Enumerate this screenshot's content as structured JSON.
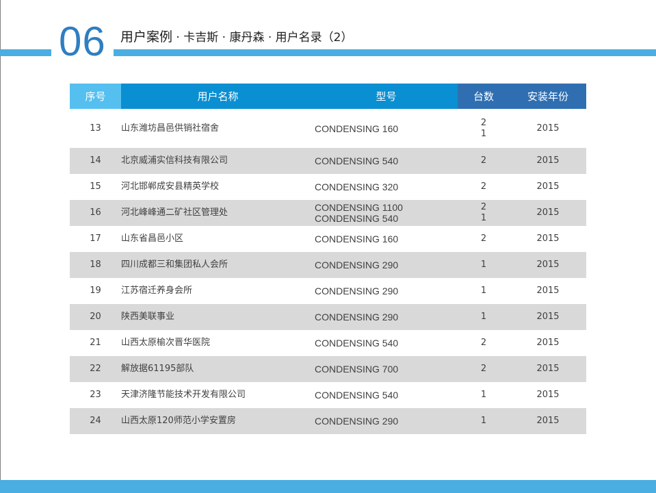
{
  "header": {
    "section_number": "06",
    "title_main": "用户案例",
    "title_sub": " · 卡吉斯 · 康丹森 · 用户名录（2）"
  },
  "table": {
    "headers": {
      "seq": "序号",
      "name": "用户名称",
      "model": "型号",
      "qty": "台数",
      "year": "安装年份"
    },
    "rows": [
      {
        "seq": "13",
        "name": "山东潍坊昌邑供销社宿舍",
        "model": [
          "CONDENSING 160"
        ],
        "qty": [
          "2",
          "1"
        ],
        "year": "2015"
      },
      {
        "seq": "14",
        "name": "北京威浦实信科技有限公司",
        "model": [
          "CONDENSING 540"
        ],
        "qty": [
          "2"
        ],
        "year": "2015"
      },
      {
        "seq": "15",
        "name": "河北邯郸成安县精英学校",
        "model": [
          "CONDENSING 320"
        ],
        "qty": [
          "2"
        ],
        "year": "2015"
      },
      {
        "seq": "16",
        "name": "河北峰峰通二矿社区管理处",
        "model": [
          "CONDENSING 1100",
          "CONDENSING 540"
        ],
        "qty": [
          "2",
          "1"
        ],
        "year": "2015"
      },
      {
        "seq": "17",
        "name": "山东省昌邑小区",
        "model": [
          "CONDENSING 160"
        ],
        "qty": [
          "2"
        ],
        "year": "2015"
      },
      {
        "seq": "18",
        "name": "四川成都三和集团私人会所",
        "model": [
          "CONDENSING 290"
        ],
        "qty": [
          "1"
        ],
        "year": "2015"
      },
      {
        "seq": "19",
        "name": "江苏宿迁养身会所",
        "model": [
          "CONDENSING 290"
        ],
        "qty": [
          "1"
        ],
        "year": "2015"
      },
      {
        "seq": "20",
        "name": "陕西美联事业",
        "model": [
          "CONDENSING 290"
        ],
        "qty": [
          "1"
        ],
        "year": "2015"
      },
      {
        "seq": "21",
        "name": "山西太原榆次晋华医院",
        "model": [
          "CONDENSING 540"
        ],
        "qty": [
          "2"
        ],
        "year": "2015"
      },
      {
        "seq": "22",
        "name": "解放据61195部队",
        "model": [
          "CONDENSING 700"
        ],
        "qty": [
          "2"
        ],
        "year": "2015"
      },
      {
        "seq": "23",
        "name": "天津济隆节能技术开发有限公司",
        "model": [
          "CONDENSING 540"
        ],
        "qty": [
          "1"
        ],
        "year": "2015"
      },
      {
        "seq": "24",
        "name": "山西太原120师范小学安置房",
        "model": [
          "CONDENSING 290"
        ],
        "qty": [
          "1"
        ],
        "year": "2015"
      }
    ]
  },
  "colors": {
    "accent_light": "#55c0f0",
    "accent_mid": "#0a8fd2",
    "accent_dark": "#2f6fb1",
    "bar": "#4aaee2",
    "row_shade": "#d9d9d9"
  }
}
